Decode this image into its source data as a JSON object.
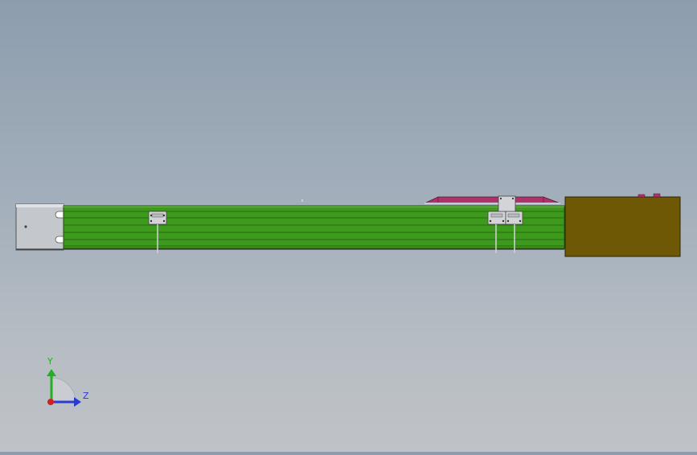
{
  "viewport": {
    "colors": {
      "background_top": "#8d9dae",
      "background_bottom": "#bfc3c7",
      "rail_green": "#3e9a1c",
      "rail_stripe": "#2c7512",
      "end_cap": "#c4c7cc",
      "trolley_magenta": "#b0326a",
      "junction_box": "#6e5806",
      "bracket": "#d2d4d8"
    }
  },
  "triad": {
    "y_label": "Y",
    "z_label": "Z",
    "colors": {
      "y_axis": "#22b022",
      "z_axis": "#2a3bd0",
      "x_axis": "#d02020"
    }
  }
}
